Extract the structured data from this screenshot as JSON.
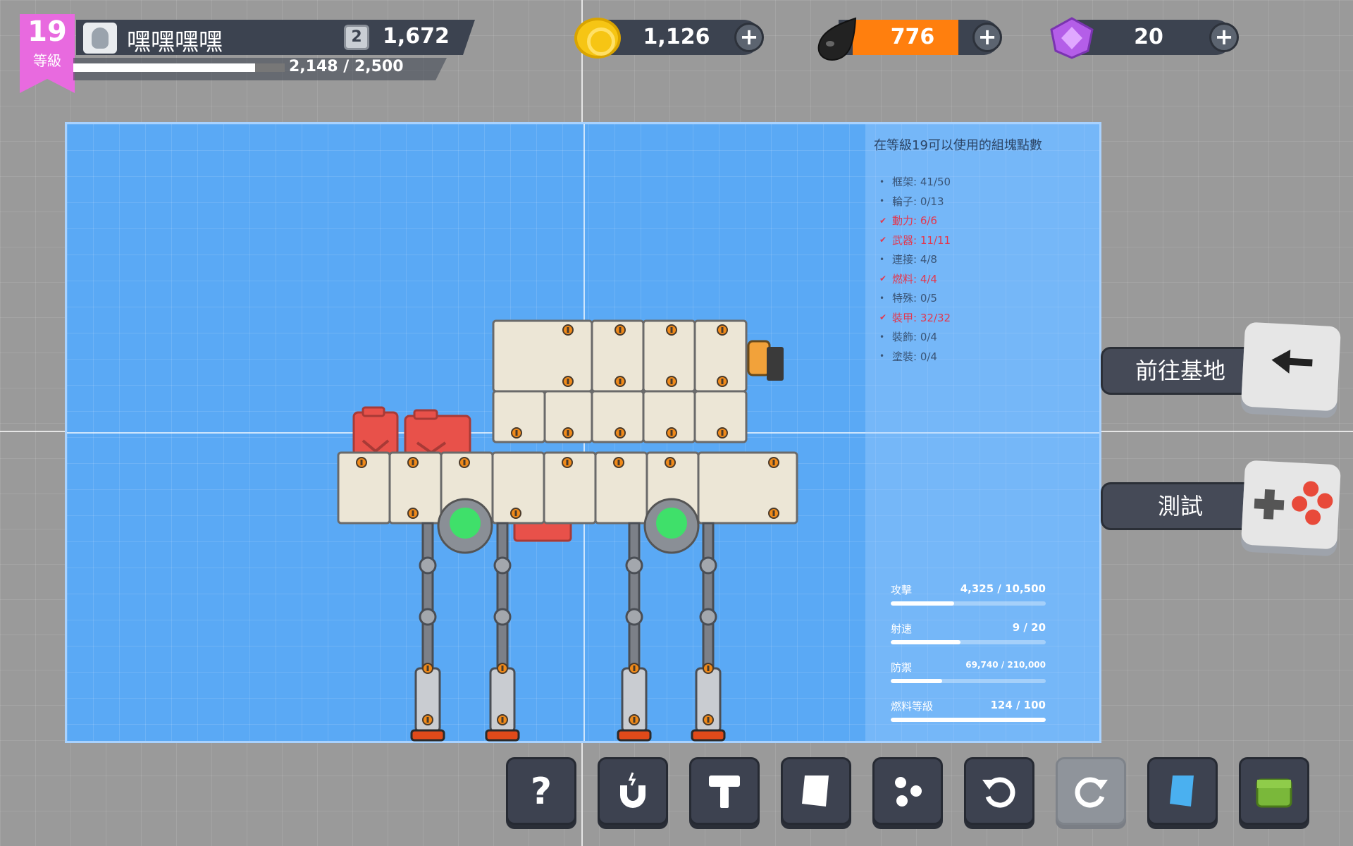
{
  "player": {
    "level": "19",
    "level_label": "等級",
    "name": "嘿嘿嘿嘿",
    "rank": "2",
    "rank_score": "1,672",
    "xp_text": "2,148 / 2,500",
    "xp_progress": 0.859
  },
  "currencies": {
    "coins": "1,126",
    "fuel": "776",
    "gems": "20"
  },
  "panel": {
    "title": "在等級19可以使用的組塊點數",
    "parts": [
      {
        "label": "框架: 41/50",
        "full": false
      },
      {
        "label": "輪子: 0/13",
        "full": false
      },
      {
        "label": "動力: 6/6",
        "full": true
      },
      {
        "label": "武器: 11/11",
        "full": true
      },
      {
        "label": "連接: 4/8",
        "full": false
      },
      {
        "label": "燃料: 4/4",
        "full": true
      },
      {
        "label": "特殊: 0/5",
        "full": false
      },
      {
        "label": "裝甲: 32/32",
        "full": true
      },
      {
        "label": "裝飾: 0/4",
        "full": false
      },
      {
        "label": "塗裝: 0/4",
        "full": false
      }
    ],
    "stats": [
      {
        "label": "攻擊",
        "value": "4,325 / 10,500",
        "progress": 0.41
      },
      {
        "label": "射速",
        "value": "9 / 20",
        "progress": 0.45
      },
      {
        "label": "防禦",
        "value": "69,740 / 210,000",
        "progress": 0.33
      },
      {
        "label": "燃料等級",
        "value": "124 / 100",
        "progress": 1.0
      }
    ],
    "full_color": "#e2384f"
  },
  "buttons": {
    "go_to_base": "前往基地",
    "test": "測試"
  },
  "toolbar": [
    "help-icon",
    "magnet-icon",
    "hammer-icon",
    "paint-icon",
    "dice-icon",
    "undo-icon",
    "redo-icon",
    "blueprint-icon",
    "crate-icon"
  ],
  "colors": {
    "build_area": "#5aa9f5",
    "level_badge": "#e86adf",
    "fuel_bar": "#ff7f0e",
    "hud_dark": "#3c4350"
  }
}
